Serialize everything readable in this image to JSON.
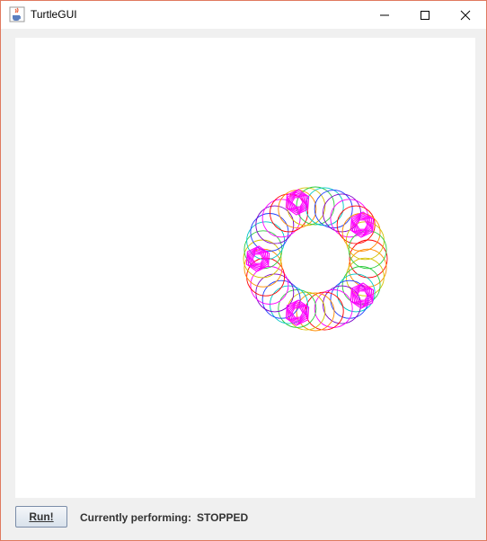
{
  "window": {
    "title": "TurtleGUI",
    "icon": "java-cup-icon"
  },
  "controls": {
    "minimize_icon": "minimize-icon",
    "maximize_icon": "maximize-icon",
    "close_icon": "close-icon"
  },
  "drawing": {
    "description_colors": [
      "#ff0000",
      "#ff8c00",
      "#d4c200",
      "#2ecc40",
      "#00c8c8",
      "#1e3cff",
      "#7a00c8",
      "#ff00ff"
    ],
    "highlight_color": "#ff00ff"
  },
  "footer": {
    "run_label": "Run!",
    "status_label": "Currently performing:",
    "status_value": "STOPPED"
  }
}
